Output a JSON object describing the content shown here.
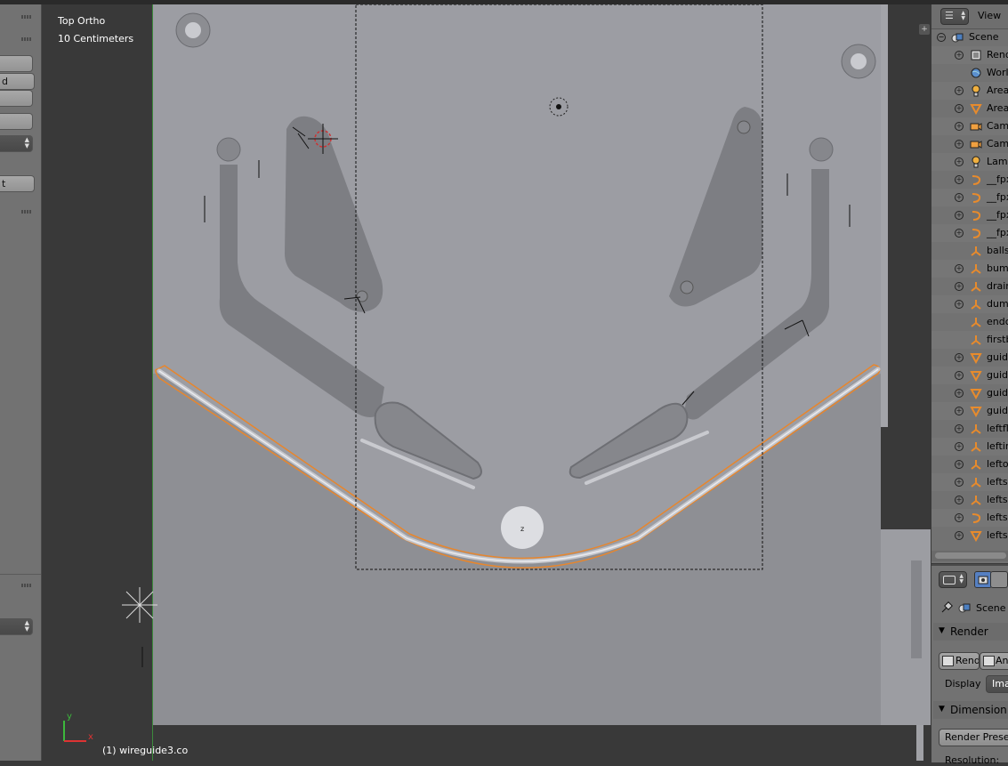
{
  "viewport": {
    "view_name": "Top Ortho",
    "scale": "10 Centimeters",
    "object_status": "(1) wireguide3.co",
    "axis_x": "x",
    "axis_y": "y",
    "empty_label": "z"
  },
  "left_panel": {
    "buttons": [
      "",
      "d",
      "",
      "",
      "",
      "t",
      "",
      ""
    ]
  },
  "outliner": {
    "view_menu": "View",
    "scene": "Scene",
    "items": [
      {
        "label": "Rend",
        "icon": "render-layers-icon",
        "expand": true
      },
      {
        "label": "Worl",
        "icon": "world-icon",
        "expand": false
      },
      {
        "label": "Area",
        "icon": "lamp-icon",
        "expand": true
      },
      {
        "label": "Area",
        "icon": "mesh-icon",
        "expand": true
      },
      {
        "label": "Cam",
        "icon": "camera-icon",
        "expand": true
      },
      {
        "label": "Cam",
        "icon": "camera-icon",
        "expand": true
      },
      {
        "label": "Lam",
        "icon": "lamp-icon",
        "expand": true
      },
      {
        "label": "__fpx",
        "icon": "curve-icon",
        "expand": true
      },
      {
        "label": "__fpx",
        "icon": "curve-icon",
        "expand": true
      },
      {
        "label": "__fpx",
        "icon": "curve-icon",
        "expand": true
      },
      {
        "label": "__fpx",
        "icon": "curve-icon",
        "expand": true
      },
      {
        "label": "balls",
        "icon": "empty-icon",
        "expand": false
      },
      {
        "label": "bum",
        "icon": "empty-icon",
        "expand": true
      },
      {
        "label": "drain",
        "icon": "empty-icon",
        "expand": true
      },
      {
        "label": "dum",
        "icon": "empty-icon",
        "expand": true
      },
      {
        "label": "endc",
        "icon": "empty-icon",
        "expand": false
      },
      {
        "label": "firstb",
        "icon": "empty-icon",
        "expand": false
      },
      {
        "label": "guide",
        "icon": "mesh-icon",
        "expand": true
      },
      {
        "label": "guide",
        "icon": "mesh-icon",
        "expand": true
      },
      {
        "label": "guide",
        "icon": "mesh-icon",
        "expand": true
      },
      {
        "label": "guide",
        "icon": "mesh-icon",
        "expand": true
      },
      {
        "label": "leftfl",
        "icon": "empty-icon",
        "expand": true
      },
      {
        "label": "leftin",
        "icon": "empty-icon",
        "expand": true
      },
      {
        "label": "lefto",
        "icon": "empty-icon",
        "expand": true
      },
      {
        "label": "leftsl",
        "icon": "empty-icon",
        "expand": true
      },
      {
        "label": "leftsl",
        "icon": "empty-icon",
        "expand": true
      },
      {
        "label": "leftsl",
        "icon": "curve-icon",
        "expand": true
      },
      {
        "label": "leftsl",
        "icon": "mesh-icon",
        "expand": true
      }
    ]
  },
  "properties": {
    "scene_label": "Scene",
    "render_panel": "Render",
    "render_button": "Rend",
    "animation_button": "An",
    "display_label": "Display",
    "display_value": "Ima",
    "dimensions_panel": "Dimension",
    "render_presets": "Render Presets",
    "resolution_label": "Resolution:"
  },
  "colors": {
    "selection": "#e8862c",
    "playfield": "#9b9ca2",
    "guide_dark": "#7b7c81",
    "panel": "#727272"
  }
}
